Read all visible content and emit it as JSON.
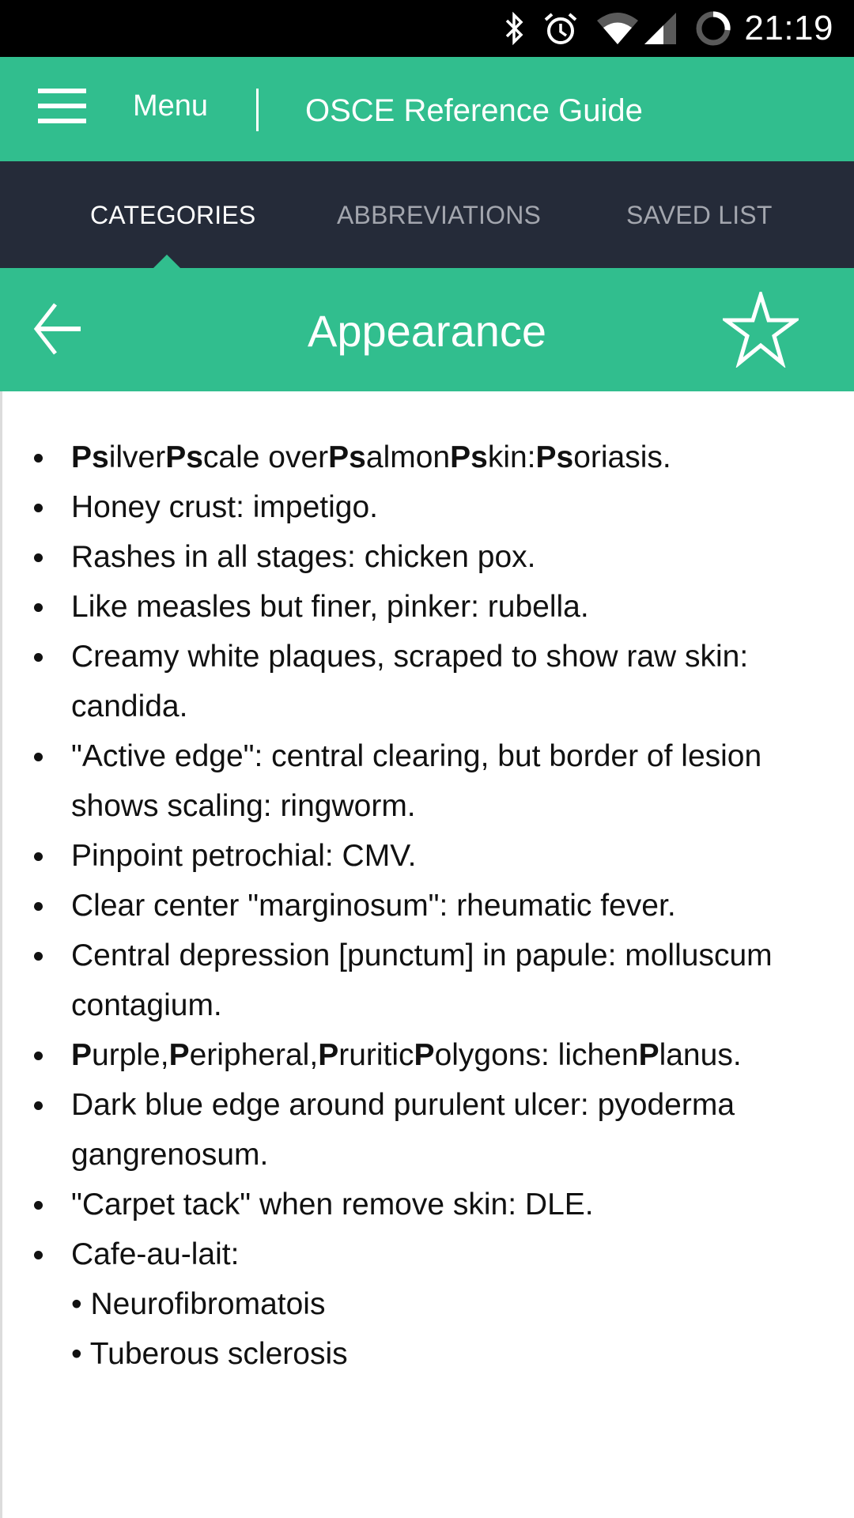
{
  "status_bar": {
    "icons": [
      "bluetooth-icon",
      "alarm-icon",
      "wifi-icon",
      "cell-signal-icon",
      "battery-charging-icon"
    ],
    "time": "21:19"
  },
  "app_bar": {
    "menu_icon": "hamburger-icon",
    "menu_label": "Menu",
    "title": "OSCE Reference Guide"
  },
  "tabs": [
    {
      "label": "CATEGORIES",
      "active": true
    },
    {
      "label": "ABBREVIATIONS",
      "active": false
    },
    {
      "label": "SAVED LIST",
      "active": false
    }
  ],
  "category": {
    "back_icon": "arrow-left-icon",
    "title": "Appearance",
    "favorite_icon": "star-outline-icon"
  },
  "colors": {
    "accent": "#31be8e",
    "tab_bar": "#252b39",
    "tab_inactive": "#a3a6ae"
  },
  "items": [
    {
      "segments": [
        {
          "t": "Ps",
          "b": true
        },
        {
          "t": "ilver",
          "b": false
        },
        {
          "t": "Ps",
          "b": true
        },
        {
          "t": "cale over",
          "b": false
        },
        {
          "t": "Ps",
          "b": true
        },
        {
          "t": "almon",
          "b": false
        },
        {
          "t": "Ps",
          "b": true
        },
        {
          "t": "kin:",
          "b": false
        },
        {
          "t": "Ps",
          "b": true
        },
        {
          "t": "oriasis.",
          "b": false
        }
      ]
    },
    {
      "segments": [
        {
          "t": "Honey crust: impetigo.",
          "b": false
        }
      ]
    },
    {
      "segments": [
        {
          "t": "Rashes in all stages: chicken pox.",
          "b": false
        }
      ]
    },
    {
      "segments": [
        {
          "t": "Like measles but finer, pinker: rubella.",
          "b": false
        }
      ]
    },
    {
      "segments": [
        {
          "t": "Creamy white plaques, scraped to show raw skin: candida.",
          "b": false
        }
      ]
    },
    {
      "segments": [
        {
          "t": "\"Active edge\": central clearing, but border of lesion shows scaling: ringworm.",
          "b": false
        }
      ]
    },
    {
      "segments": [
        {
          "t": "Pinpoint petrochial: CMV.",
          "b": false
        }
      ]
    },
    {
      "segments": [
        {
          "t": "Clear center \"marginosum\": rheumatic fever.",
          "b": false
        }
      ]
    },
    {
      "segments": [
        {
          "t": "Central depression [punctum] in papule: molluscum contagium.",
          "b": false
        }
      ]
    },
    {
      "segments": [
        {
          "t": "P",
          "b": true
        },
        {
          "t": "urple,",
          "b": false
        },
        {
          "t": "P",
          "b": true
        },
        {
          "t": "eripheral,",
          "b": false
        },
        {
          "t": "P",
          "b": true
        },
        {
          "t": "ruritic",
          "b": false
        },
        {
          "t": "P",
          "b": true
        },
        {
          "t": "olygons: lichen",
          "b": false
        },
        {
          "t": "P",
          "b": true
        },
        {
          "t": "lanus.",
          "b": false
        }
      ]
    },
    {
      "segments": [
        {
          "t": "Dark blue edge around purulent ulcer: pyoderma gangrenosum.",
          "b": false
        }
      ]
    },
    {
      "segments": [
        {
          "t": "\"Carpet tack\" when remove skin: DLE.",
          "b": false
        }
      ]
    },
    {
      "segments": [
        {
          "t": "Cafe-au-lait:",
          "b": false
        }
      ],
      "sub_items": [
        "• Neurofibromatois",
        "• Tuberous sclerosis"
      ]
    }
  ]
}
